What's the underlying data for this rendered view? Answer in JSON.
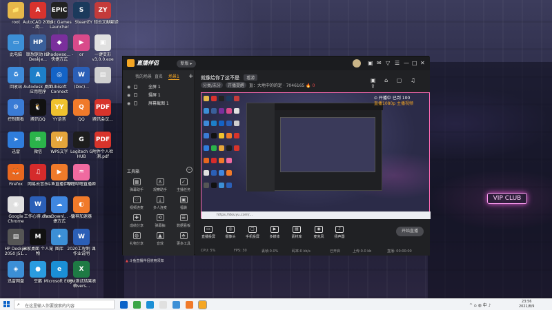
{
  "desktop": {
    "icons": [
      {
        "label": "root",
        "glyph": "📁",
        "color": "#e6b84a"
      },
      {
        "label": "AutoCAD 2020 - 简...",
        "glyph": "A",
        "color": "#d9332e"
      },
      {
        "label": "Epic Games Launcher",
        "glyph": "EPIC",
        "color": "#222222"
      },
      {
        "label": "Steam",
        "glyph": "S",
        "color": "#1b3a5c"
      },
      {
        "label": "ZY 知云文献翻译",
        "glyph": "ZY",
        "color": "#c43b3b"
      },
      {
        "label": "此电脑",
        "glyph": "▭",
        "color": "#3c8fd6"
      },
      {
        "label": "联想驱动 HP Deskje...",
        "glyph": "HP",
        "color": "#3a5f9a"
      },
      {
        "label": "Shadowso... -快捷方式",
        "glyph": "◆",
        "color": "#7a2f9c"
      },
      {
        "label": "or",
        "glyph": "▶",
        "color": "#d94a8a"
      },
      {
        "label": "一键变形 v3.0.0.exe",
        "glyph": "▣",
        "color": "#e0e0e0"
      },
      {
        "label": "回收站",
        "glyph": "♻",
        "color": "#3d8ad9"
      },
      {
        "label": "Autodesk 桌面应用程序",
        "glyph": "A",
        "color": "#1d7fc9"
      },
      {
        "label": "Ubisoft Connect",
        "glyph": "◎",
        "color": "#1463c6"
      },
      {
        "label": "(Doc)...",
        "glyph": "W",
        "color": "#2b5fb7"
      },
      {
        "label": "",
        "glyph": "▤",
        "color": "#d0d0d0"
      },
      {
        "label": "控制面板",
        "glyph": "⚙",
        "color": "#3a7bd5"
      },
      {
        "label": "腾讯QQ",
        "glyph": "🐧",
        "color": "#111111"
      },
      {
        "label": "YY语音",
        "glyph": "YY",
        "color": "#f0c22e"
      },
      {
        "label": "QQ",
        "glyph": "Q",
        "color": "#f07a2a"
      },
      {
        "label": "腾讯会议...",
        "glyph": "PDF",
        "color": "#d8342b"
      },
      {
        "label": "迅雷",
        "glyph": "➤",
        "color": "#2f7ddc"
      },
      {
        "label": "微信",
        "glyph": "✉",
        "color": "#2bb34a"
      },
      {
        "label": "WPS文字",
        "glyph": "W",
        "color": "#e5a53b"
      },
      {
        "label": "Logitech G HUB",
        "glyph": "G",
        "color": "#1d1d1d"
      },
      {
        "label": "附件个人检测.pdf",
        "glyph": "PDF",
        "color": "#d8342b"
      },
      {
        "label": "Firefox",
        "glyph": "🦊",
        "color": "#e8671f"
      },
      {
        "label": "网易云音乐",
        "glyph": "♫",
        "color": "#d52b2b"
      },
      {
        "label": "斗鱼直播伴侣",
        "glyph": "▶",
        "color": "#f07a2a"
      },
      {
        "label": "哔哩哔哩直播姬",
        "glyph": "♒",
        "color": "#f06aa0"
      },
      {
        "label": "",
        "glyph": "",
        "color": "rgba(0,0,0,0)"
      },
      {
        "label": "Google Chrome",
        "glyph": "◉",
        "color": "#e0e0e0"
      },
      {
        "label": "工作心得.docx",
        "glyph": "W",
        "color": "#2b5fb7"
      },
      {
        "label": "PanDownl... -快捷方式",
        "glyph": "☁",
        "color": "#3f87e0"
      },
      {
        "label": "雷神加速器",
        "glyph": "◐",
        "color": "#f07a2a"
      },
      {
        "label": "",
        "glyph": "",
        "color": "rgba(0,0,0,0)"
      },
      {
        "label": "HP Deskjet 2050 J51...",
        "glyph": "▤",
        "color": "#555555"
      },
      {
        "label": "米家桌面 个人宠物",
        "glyph": "M",
        "color": "#111111"
      },
      {
        "label": "图库",
        "glyph": "✦",
        "color": "#3c8fd6"
      },
      {
        "label": "2020工程制 课作业说明",
        "glyph": "W",
        "color": "#2b5fb7"
      },
      {
        "label": "",
        "glyph": "",
        "color": "rgba(0,0,0,0)"
      },
      {
        "label": "迅雷网盘",
        "glyph": "◈",
        "color": "#3c8fd6"
      },
      {
        "label": "空鹏",
        "glyph": "●",
        "color": "#2a9ce0"
      },
      {
        "label": "Microsoft Edge",
        "glyph": "e",
        "color": "#1b8fd6"
      },
      {
        "label": "UPU测试结果表格vers...",
        "glyph": "X",
        "color": "#1e7a44"
      }
    ],
    "neon_sign": "VIP CLUB"
  },
  "window": {
    "app_name": "直播伴侣",
    "version_pill": "新版 ▸",
    "titlebar_icons": [
      "▣",
      "✉",
      "▽",
      "☰",
      "—",
      "□",
      "✕"
    ],
    "sidebar": {
      "tabs": [
        "我的场景",
        "直名",
        "场景1"
      ],
      "add": "+",
      "sources": [
        "全屏 1",
        "摄屏 1",
        "屏幕截图 1"
      ],
      "tools_header": "工具箱",
      "tools": [
        {
          "glyph": "▦",
          "label": "弹幕助手"
        },
        {
          "glyph": "♙",
          "label": "观察助手"
        },
        {
          "glyph": "✓",
          "label": "主播任务"
        },
        {
          "glyph": "♡",
          "label": "视频连麦"
        },
        {
          "glyph": "⤓",
          "label": "多人连麦"
        },
        {
          "glyph": "▣",
          "label": "福袋"
        },
        {
          "glyph": "✚",
          "label": "成绩分享"
        },
        {
          "glyph": "⟲",
          "label": "弹幕抽"
        },
        {
          "glyph": "☰",
          "label": "数据看板"
        },
        {
          "glyph": "◍",
          "label": "礼物分享"
        },
        {
          "glyph": "▲",
          "label": "音效"
        },
        {
          "glyph": "⬘",
          "label": "更多工具"
        }
      ],
      "warning": "斗鱼直播伴侣使用须知"
    },
    "main": {
      "title": "就像给你了这不是",
      "title_badge": "看游",
      "meta_tags": [
        "分类/未分",
        "开播提醒"
      ],
      "meta_text": "直：大地中的的定 · 7046165",
      "meta_hot": "🔥 0",
      "right_icons": "▣ ⌂ ▢ ♫ ⇪",
      "stage_overlay_1": "⊙ 开播中 已到 100",
      "stage_overlay_2": "直播1080p 主播视频",
      "stage_url": "https://douyu.com/...",
      "controls": [
        {
          "glyph": "▭",
          "label": "直播投屏"
        },
        {
          "glyph": "◎",
          "label": "摄像头"
        },
        {
          "glyph": "▢",
          "label": "手机投屏"
        },
        {
          "glyph": "▶",
          "label": "多媒体"
        },
        {
          "glyph": "▤",
          "label": "素材库"
        },
        {
          "glyph": "◉",
          "label": "麦克风"
        },
        {
          "glyph": "♪",
          "label": "扬声器"
        }
      ],
      "live_button": "开始直播",
      "status": [
        "CPU: 5%",
        "FPS: 30",
        "丢帧:0.0%",
        "码率:0 kb/s",
        "已开启",
        "上传:0.0 kb",
        "直播: 00:00:00"
      ]
    }
  },
  "taskbar": {
    "search_placeholder": "在这里输入你要搜索的内容",
    "apps": [
      "#0a62c8",
      "#3aa547",
      "#1b8fd6",
      "#e0e0e0",
      "#3c8fd6",
      "#f07a2a",
      "#f5a623"
    ],
    "tray": "^ ⌂ ◍ 中 ♪",
    "time": "23:56",
    "date": "2021/8/9"
  }
}
